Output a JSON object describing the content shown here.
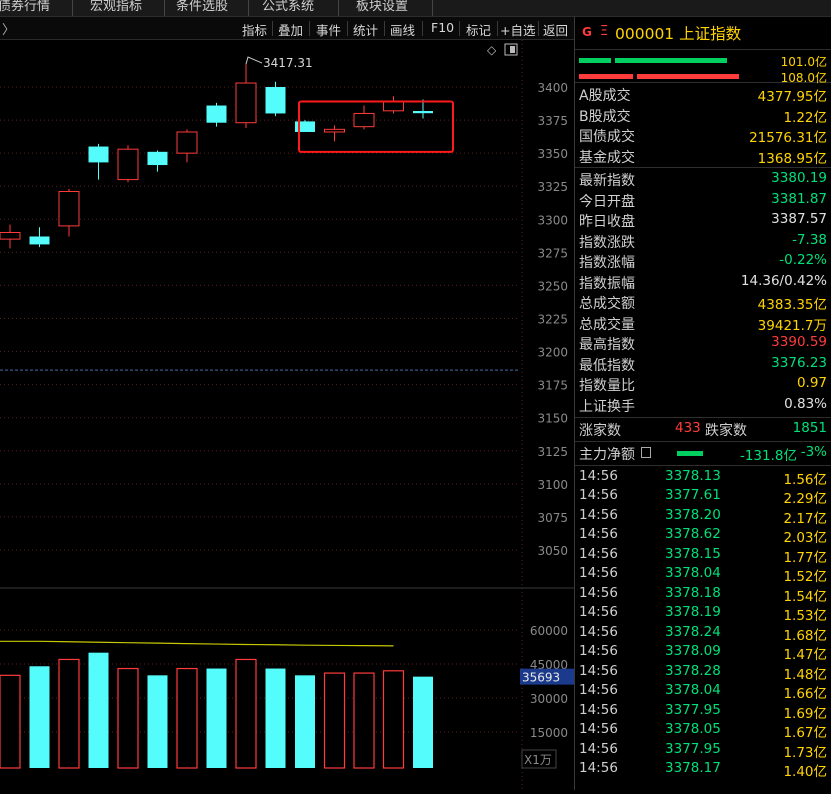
{
  "top_menu": [
    "债券行情",
    "宏观指标",
    "条件选股",
    "公式系统",
    "板块设置"
  ],
  "toolbar": {
    "arrow": "〉",
    "buttons": [
      "指标",
      "叠加",
      "事件",
      "统计",
      "画线",
      "F10",
      "标记",
      "+自选",
      "返回"
    ]
  },
  "chart_data": {
    "type": "candlestick",
    "y_ticks": [
      3400,
      3375,
      3350,
      3325,
      3300,
      3275,
      3250,
      3225,
      3200,
      3175,
      3150,
      3125,
      3100,
      3075,
      3050
    ],
    "annotation": "3417.31",
    "candles": [
      {
        "open": 3285,
        "close": 3290,
        "high": 3296,
        "low": 3278,
        "color": "red"
      },
      {
        "open": 3287,
        "close": 3281,
        "high": 3294,
        "low": 3279,
        "color": "cyan"
      },
      {
        "open": 3295,
        "close": 3321,
        "high": 3323,
        "low": 3287,
        "color": "red"
      },
      {
        "open": 3355,
        "close": 3343,
        "high": 3357,
        "low": 3330,
        "color": "cyan"
      },
      {
        "open": 3330,
        "close": 3353,
        "high": 3356,
        "low": 3328,
        "color": "red"
      },
      {
        "open": 3351,
        "close": 3341,
        "high": 3352,
        "low": 3336,
        "color": "cyan"
      },
      {
        "open": 3350,
        "close": 3366,
        "high": 3368,
        "low": 3343,
        "color": "red"
      },
      {
        "open": 3386,
        "close": 3373,
        "high": 3388,
        "low": 3370,
        "color": "cyan"
      },
      {
        "open": 3373,
        "close": 3403,
        "high": 3417.31,
        "low": 3369,
        "color": "red"
      },
      {
        "open": 3400,
        "close": 3380,
        "high": 3404,
        "low": 3378,
        "color": "cyan"
      },
      {
        "open": 3374,
        "close": 3366,
        "high": 3375,
        "low": 3366,
        "color": "cyan"
      },
      {
        "open": 3366,
        "close": 3368,
        "high": 3371,
        "low": 3359,
        "color": "red"
      },
      {
        "open": 3370,
        "close": 3380,
        "high": 3386,
        "low": 3368,
        "color": "red"
      },
      {
        "open": 3382,
        "close": 3389,
        "high": 3393,
        "low": 3380,
        "color": "red"
      },
      {
        "open": 3381.87,
        "close": 3380.19,
        "high": 3390.59,
        "low": 3376.23,
        "color": "cyan"
      }
    ],
    "volume": {
      "y_ticks": [
        60000,
        45000,
        30000,
        15000
      ],
      "current_label": "35693",
      "unit": "X1万",
      "bars": [
        {
          "value": 40000,
          "color": "red"
        },
        {
          "value": 44000,
          "color": "cyan"
        },
        {
          "value": 47000,
          "color": "red"
        },
        {
          "value": 50000,
          "color": "cyan"
        },
        {
          "value": 43000,
          "color": "red"
        },
        {
          "value": 40000,
          "color": "cyan"
        },
        {
          "value": 43000,
          "color": "red"
        },
        {
          "value": 43000,
          "color": "cyan"
        },
        {
          "value": 47000,
          "color": "red"
        },
        {
          "value": 43000,
          "color": "cyan"
        },
        {
          "value": 40000,
          "color": "cyan"
        },
        {
          "value": 41000,
          "color": "red"
        },
        {
          "value": 41000,
          "color": "red"
        },
        {
          "value": 42000,
          "color": "red"
        },
        {
          "value": 39422,
          "color": "cyan"
        }
      ],
      "ma_line": [
        55000,
        55000,
        54800,
        54600,
        54400,
        54200,
        54000,
        53800,
        53600,
        53500,
        53300,
        53200,
        53100,
        53000
      ]
    }
  },
  "panel": {
    "g": "G",
    "eq": "Ξ",
    "code_name": "000001 上证指数",
    "bar_values": [
      "101.0亿",
      "108.0亿"
    ],
    "rows": [
      {
        "label": "A股成交",
        "value": "4377.95亿",
        "color": "yellow"
      },
      {
        "label": "B股成交",
        "value": "1.22亿",
        "color": "yellow"
      },
      {
        "label": "国债成交",
        "value": "21576.31亿",
        "color": "yellow"
      },
      {
        "label": "基金成交",
        "value": "1368.95亿",
        "color": "yellow"
      },
      {
        "label": "最新指数",
        "value": "3380.19",
        "color": "green"
      },
      {
        "label": "今日开盘",
        "value": "3381.87",
        "color": "green"
      },
      {
        "label": "昨日收盘",
        "value": "3387.57",
        "color": "white"
      },
      {
        "label": "指数涨跌",
        "value": "-7.38",
        "color": "green"
      },
      {
        "label": "指数涨幅",
        "value": "-0.22%",
        "color": "green"
      },
      {
        "label": "指数振幅",
        "value": "14.36/0.42%",
        "color": "white"
      },
      {
        "label": "总成交额",
        "value": "4383.35亿",
        "color": "yellow"
      },
      {
        "label": "总成交量",
        "value": "39421.7万",
        "color": "yellow"
      },
      {
        "label": "最高指数",
        "value": "3390.59",
        "color": "red"
      },
      {
        "label": "最低指数",
        "value": "3376.23",
        "color": "green"
      },
      {
        "label": "指数量比",
        "value": "0.97",
        "color": "yellow"
      },
      {
        "label": "上证换手",
        "value": "0.83%",
        "color": "white"
      }
    ],
    "breadth": {
      "up_label": "涨家数",
      "up": "433",
      "down_label": "跌家数",
      "down": "1851"
    },
    "mainforce": {
      "label": "主力净额",
      "value": "-131.8亿",
      "pct": "-3%"
    },
    "ticks": [
      {
        "time": "14:56",
        "price": "3378.13",
        "amount": "1.56亿"
      },
      {
        "time": "14:56",
        "price": "3377.61",
        "amount": "2.29亿"
      },
      {
        "time": "14:56",
        "price": "3378.20",
        "amount": "2.17亿"
      },
      {
        "time": "14:56",
        "price": "3378.62",
        "amount": "2.03亿"
      },
      {
        "time": "14:56",
        "price": "3378.15",
        "amount": "1.77亿"
      },
      {
        "time": "14:56",
        "price": "3378.04",
        "amount": "1.52亿"
      },
      {
        "time": "14:56",
        "price": "3378.18",
        "amount": "1.54亿"
      },
      {
        "time": "14:56",
        "price": "3378.19",
        "amount": "1.53亿"
      },
      {
        "time": "14:56",
        "price": "3378.24",
        "amount": "1.68亿"
      },
      {
        "time": "14:56",
        "price": "3378.09",
        "amount": "1.47亿"
      },
      {
        "time": "14:56",
        "price": "3378.28",
        "amount": "1.48亿"
      },
      {
        "time": "14:56",
        "price": "3378.04",
        "amount": "1.66亿"
      },
      {
        "time": "14:56",
        "price": "3377.95",
        "amount": "1.69亿"
      },
      {
        "time": "14:56",
        "price": "3378.05",
        "amount": "1.67亿"
      },
      {
        "time": "14:56",
        "price": "3377.95",
        "amount": "1.73亿"
      },
      {
        "time": "14:56",
        "price": "3378.17",
        "amount": "1.40亿"
      }
    ],
    "colors": {
      "yellow": "#ffd400",
      "green": "#00e07a",
      "red": "#ff3b3b",
      "white": "#e0e0e0",
      "cyan": "#54fcfc"
    }
  }
}
